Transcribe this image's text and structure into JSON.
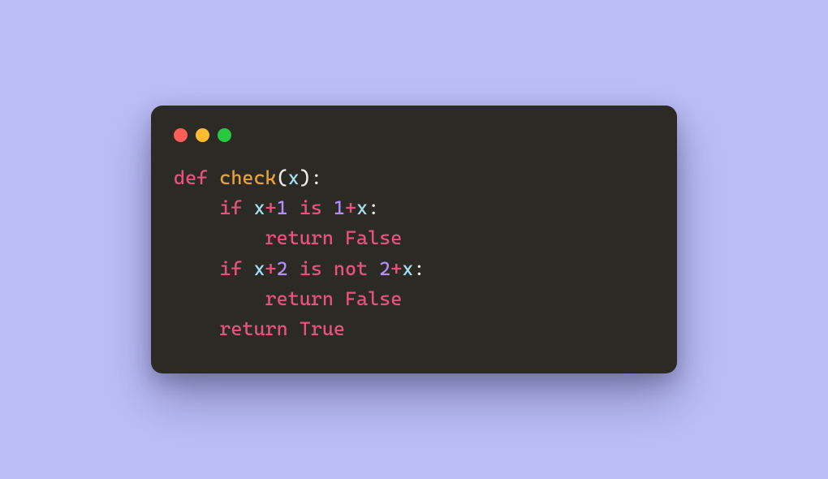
{
  "window": {
    "buttons": {
      "close": "close",
      "minimize": "minimize",
      "zoom": "zoom"
    }
  },
  "code": {
    "line1": {
      "def": "def",
      "sp": " ",
      "fn": "check",
      "lp": "(",
      "param": "x",
      "rp": ")",
      "colon": ":"
    },
    "line2": {
      "indent": "    ",
      "if": "if",
      "sp1": " ",
      "x1": "x",
      "op1": "+",
      "n1": "1",
      "sp2": " ",
      "is": "is",
      "sp3": " ",
      "n2": "1",
      "op2": "+",
      "x2": "x",
      "colon": ":"
    },
    "line3": {
      "indent": "        ",
      "return": "return",
      "sp": " ",
      "val": "False"
    },
    "line4": {
      "indent": "    ",
      "if": "if",
      "sp1": " ",
      "x1": "x",
      "op1": "+",
      "n1": "2",
      "sp2": " ",
      "is": "is",
      "sp3": " ",
      "not": "not",
      "sp4": " ",
      "n2": "2",
      "op2": "+",
      "x2": "x",
      "colon": ":"
    },
    "line5": {
      "indent": "        ",
      "return": "return",
      "sp": " ",
      "val": "False"
    },
    "line6": {
      "indent": "    ",
      "return": "return",
      "sp": " ",
      "val": "True"
    }
  }
}
